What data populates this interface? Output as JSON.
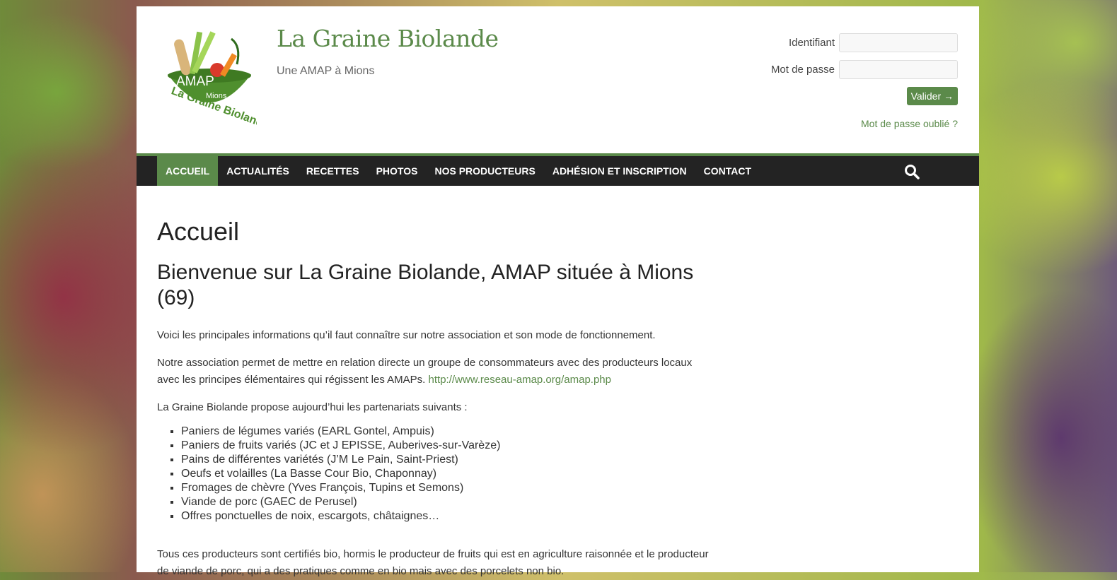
{
  "header": {
    "site_title": "La Graine Biolande",
    "site_description": "Une AMAP à Mions",
    "logo": {
      "text_amap": "AMAP",
      "text_town": "Mions",
      "text_name": "La Graine Biolande"
    }
  },
  "login": {
    "username_label": "Identifiant",
    "password_label": "Mot de passe",
    "submit_label": "Valider →",
    "forgot_label": "Mot de passe oublié ?"
  },
  "nav": {
    "items": [
      {
        "label": "ACCUEIL",
        "active": true
      },
      {
        "label": "ACTUALITÉS"
      },
      {
        "label": "RECETTES"
      },
      {
        "label": "PHOTOS"
      },
      {
        "label": "NOS PRODUCTEURS"
      },
      {
        "label": "ADHÉSION ET INSCRIPTION"
      },
      {
        "label": "CONTACT"
      }
    ],
    "search_icon": "search-icon"
  },
  "content": {
    "title": "Accueil",
    "headline": "Bienvenue sur La Graine Biolande, AMAP située à Mions (69)",
    "intro": "Voici les principales informations qu’il faut connaître sur notre association et son mode de fonctionnement.",
    "assoc_text": "Notre association permet de mettre en relation directe un groupe de consommateurs avec des producteurs locaux avec les principes élémentaires qui régissent les AMAPs.",
    "assoc_link": "http://www.reseau-amap.org/amap.php",
    "partners_intro": "La Graine Biolande propose aujourd’hui les partenariats suivants :",
    "partners": [
      "Paniers de légumes variés (EARL Gontel, Ampuis)",
      "Paniers de fruits variés (JC et J EPISSE, Auberives-sur-Varèze)",
      "Pains de différentes variétés (J’M Le Pain, Saint-Priest)",
      "Oeufs et volailles (La Basse Cour Bio, Chaponnay)",
      "Fromages de chèvre (Yves François, Tupins et Semons)",
      "Viande de porc (GAEC de Perusel)",
      "Offres ponctuelles de noix, escargots, châtaignes…"
    ],
    "certification": "Tous ces producteurs sont certifiés bio, hormis le producteur de fruits qui est en agriculture raisonnée et le producteur de viande de porc, qui a des pratiques comme en bio mais avec des porcelets non bio."
  },
  "colors": {
    "accent": "#5b8a4a",
    "nav_bg": "#232323"
  }
}
